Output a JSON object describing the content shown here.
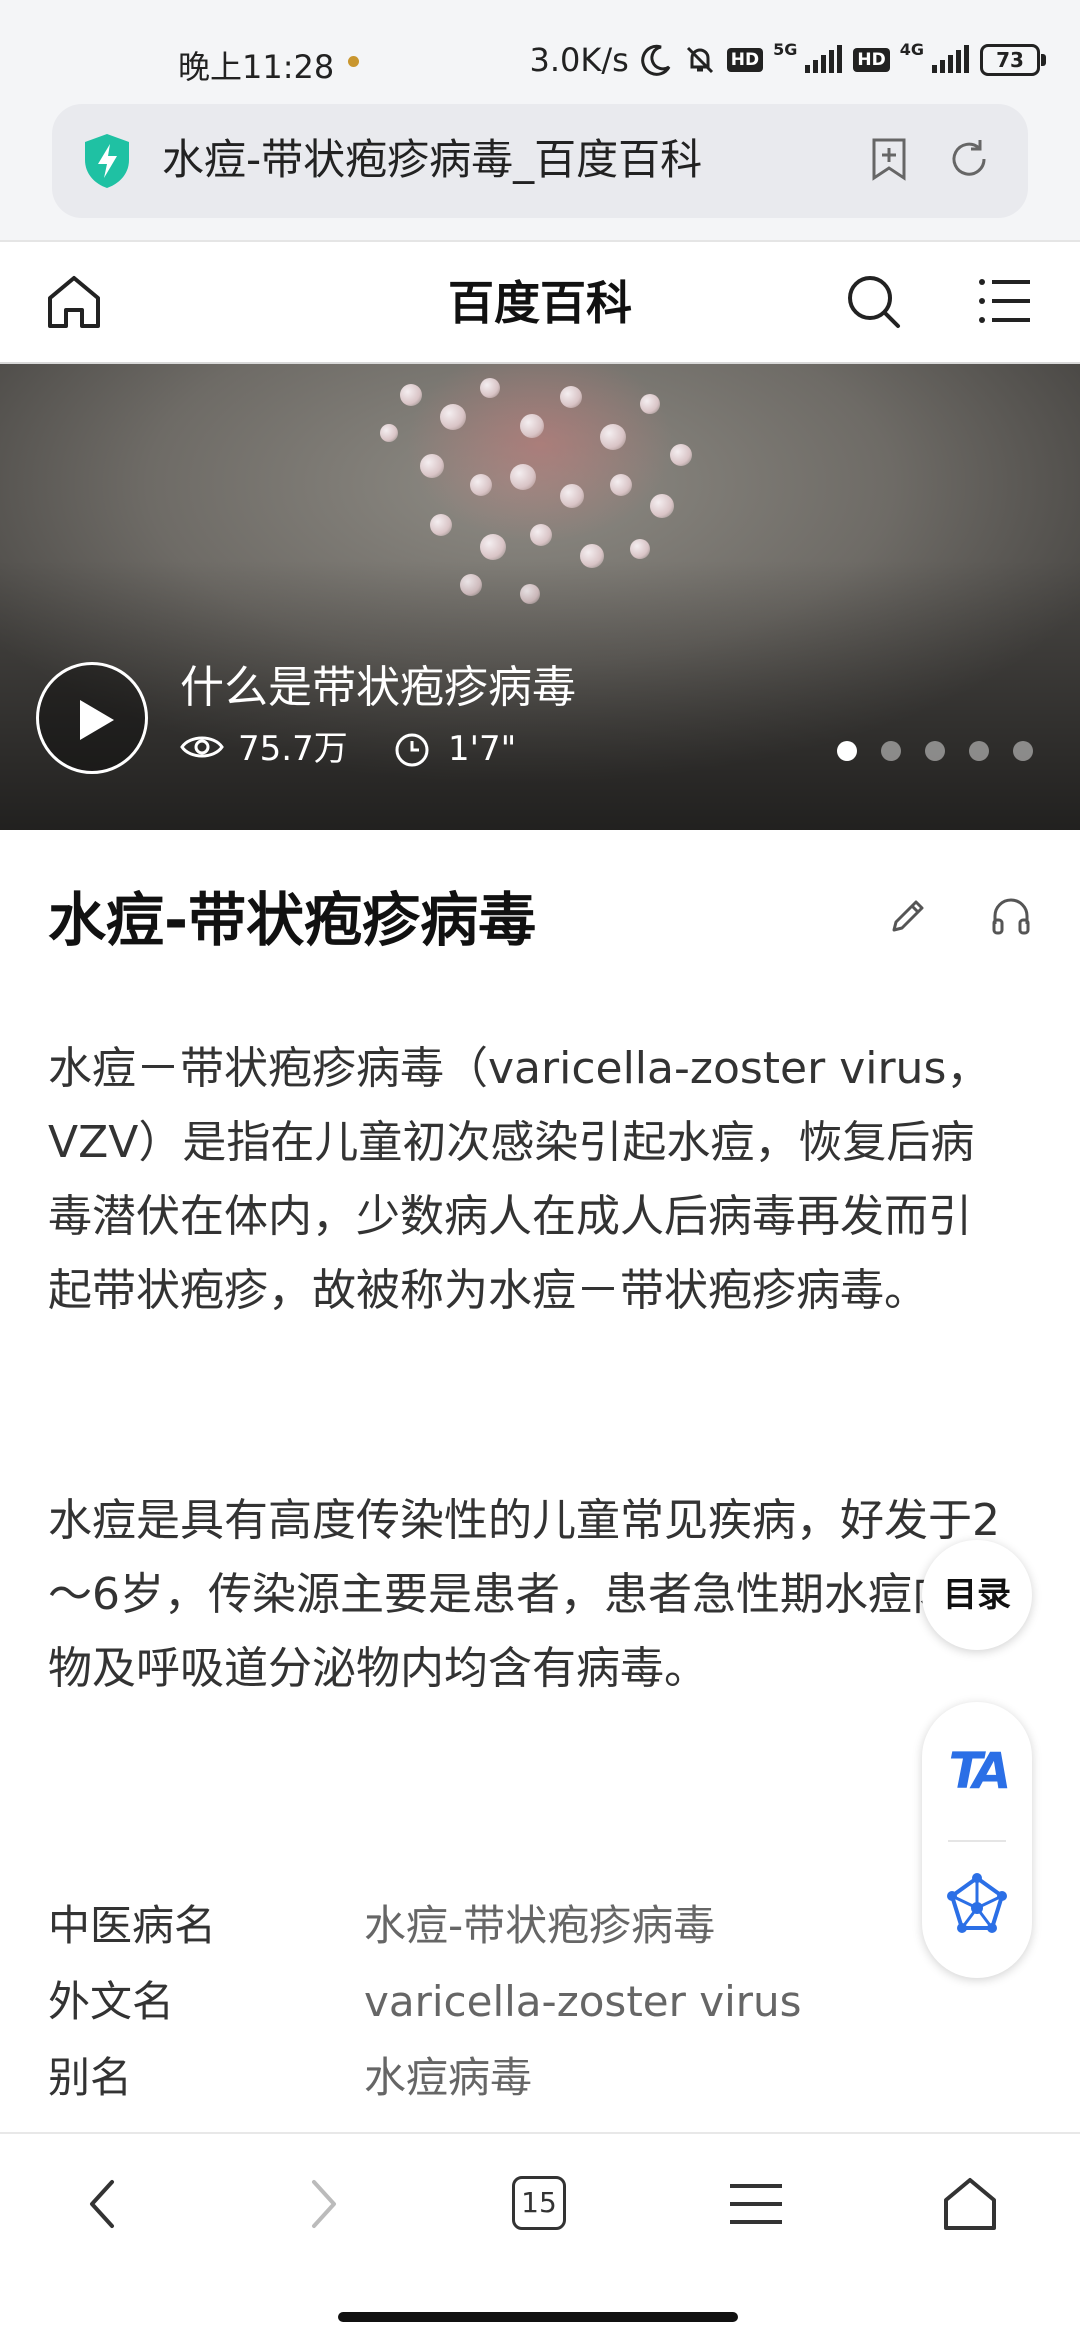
{
  "status_bar": {
    "time": "晚上11:28",
    "speed": "3.0K/s",
    "net1": "5G",
    "net2": "4G",
    "hd": "HD",
    "battery": "73",
    "icons": [
      "moon-icon",
      "bell-off-icon",
      "signal-icon",
      "signal-icon",
      "battery-icon"
    ]
  },
  "browser": {
    "page_title": "水痘-带状疱疹病毒_百度百科",
    "icons": [
      "shield-icon",
      "add-bookmark-icon",
      "reload-icon"
    ],
    "shield_color": "#1fc1a3"
  },
  "header": {
    "site_name": "百度百科",
    "icons": [
      "home-icon",
      "search-icon",
      "menu-icon"
    ]
  },
  "video": {
    "title": "什么是带状疱疹病毒",
    "views": "75.7万",
    "duration": "1'7\"",
    "carousel_dots": 5,
    "active_dot": 1
  },
  "article": {
    "title": "水痘-带状疱疹病毒",
    "paragraphs": [
      "水痘－带状疱疹病毒（varicella-zoster virus，VZV）是指在儿童初次感染引起水痘，恢复后病毒潜伏在体内，少数病人在成人后病毒再发而引起带状疱疹，故被称为水痘－带状疱疹病毒。",
      "水痘是具有高度传染性的儿童常见疾病，好发于2～6岁，传染源主要是患者，患者急性期水痘内容物及呼吸道分泌物内均含有病毒。"
    ],
    "info": [
      {
        "label": "中医病名",
        "value": "水痘-带状疱疹病毒"
      },
      {
        "label": "外文名",
        "value": "varicella-zoster virus"
      },
      {
        "label": "别名",
        "value": "水痘病毒"
      }
    ]
  },
  "floating": {
    "toc_label": "目录",
    "font_icon_text": "TA",
    "accent_color": "#2b6fe6"
  },
  "bottom_nav": {
    "tab_count": "15",
    "icons": [
      "back-icon",
      "forward-icon",
      "tabs-icon",
      "menu-icon",
      "home-icon"
    ]
  }
}
